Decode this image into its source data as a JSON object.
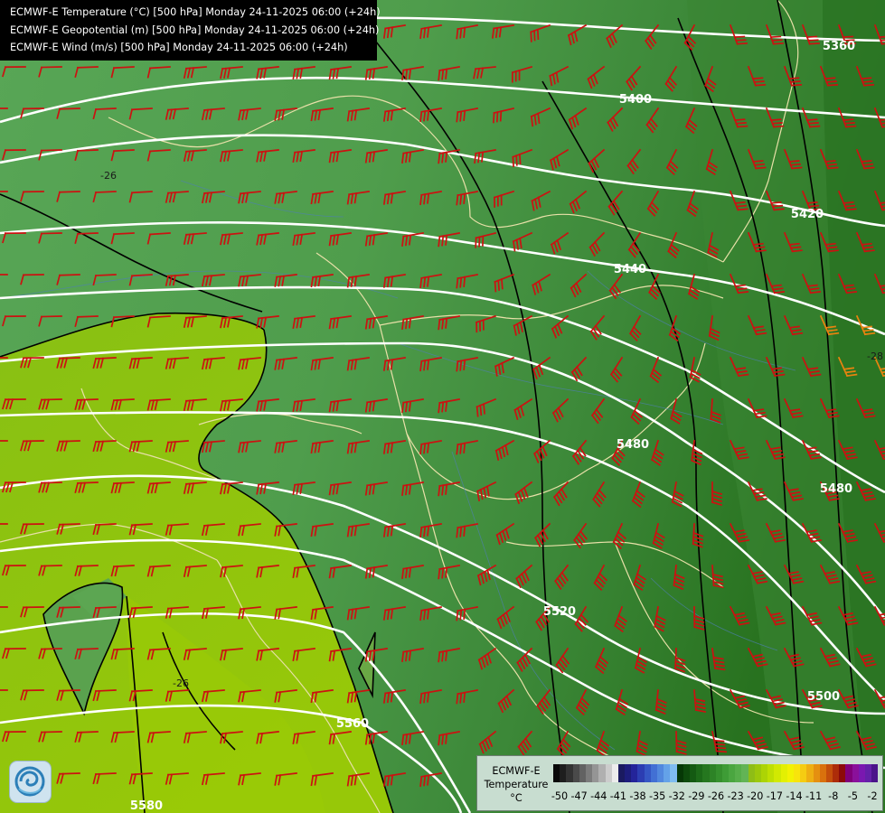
{
  "header": {
    "layers": [
      "ECMWF-E Temperature (°C) [500 hPa] Monday 24-11-2025 06:00 (+24h)",
      "ECMWF-E Geopotential (m) [500 hPa] Monday 24-11-2025 06:00 (+24h)",
      "ECMWF-E Wind (m/s) [500 hPa] Monday 24-11-2025 06:00 (+24h)"
    ]
  },
  "map": {
    "logo_icon": "swirl-logo-icon",
    "geopotential_contours_m": [
      "5360",
      "5400",
      "5420",
      "5440",
      "5480",
      "5480",
      "5500",
      "5520",
      "5560",
      "5580"
    ],
    "temperature_contour_labels": [
      "-26",
      "-28",
      "-26"
    ]
  },
  "legend": {
    "title_lines": [
      "ECMWF-E",
      "Temperature",
      "°C"
    ],
    "tick_labels": [
      "-50",
      "-47",
      "-44",
      "-41",
      "-38",
      "-35",
      "-32",
      "-29",
      "-26",
      "-23",
      "-20",
      "-17",
      "-14",
      "-11",
      "-8",
      "-5",
      "-2"
    ],
    "colors": [
      "#080808",
      "#1e1e1e",
      "#333333",
      "#4a4a4a",
      "#626262",
      "#7b7b7b",
      "#959595",
      "#b0b0b0",
      "#cccccc",
      "#ececec",
      "#1a1a60",
      "#1d1d7c",
      "#24249a",
      "#2c3db2",
      "#3556c4",
      "#4270d4",
      "#5188de",
      "#64a2e8",
      "#7fbcf0",
      "#063806",
      "#0d4a0c",
      "#145a12",
      "#1c6a18",
      "#25771f",
      "#2d8326",
      "#35902d",
      "#3e9c36",
      "#4aa640",
      "#56ae4a",
      "#62b455",
      "#8ebd16",
      "#9cc80b",
      "#acd405",
      "#bedf02",
      "#d1e902",
      "#e3f002",
      "#f2f203",
      "#f8e40c",
      "#f5cc12",
      "#eeaf12",
      "#e59010",
      "#d9710d",
      "#c44e0b",
      "#ad2c09",
      "#8c0a0a",
      "#80007a",
      "#8a109a",
      "#7a18b0",
      "#6420a8",
      "#4a148a"
    ],
    "accent_contour": "#ffffff",
    "wind_barb_color": "#cc1111",
    "border_color": "#e8e0a8",
    "temperature_isoline_color": "#000000"
  }
}
